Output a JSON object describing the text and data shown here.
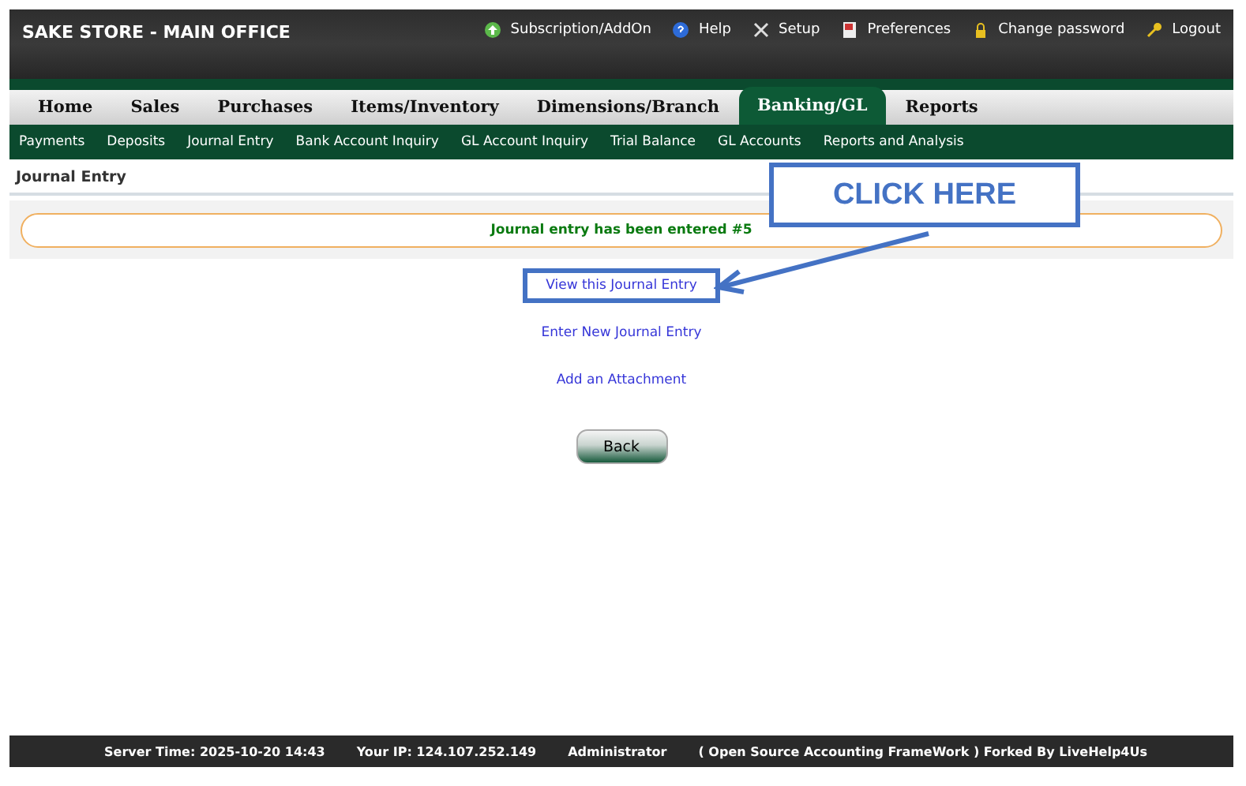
{
  "header": {
    "company": "SAKE STORE - MAIN OFFICE",
    "links": [
      {
        "kind": "addon",
        "label": "Subscription/AddOn"
      },
      {
        "kind": "help",
        "label": "Help"
      },
      {
        "kind": "setup",
        "label": "Setup"
      },
      {
        "kind": "preferences",
        "label": "Preferences"
      },
      {
        "kind": "password",
        "label": "Change password"
      },
      {
        "kind": "logout",
        "label": "Logout"
      }
    ]
  },
  "tabs": [
    {
      "label": "Home",
      "selected": false
    },
    {
      "label": "Sales",
      "selected": false
    },
    {
      "label": "Purchases",
      "selected": false
    },
    {
      "label": "Items/Inventory",
      "selected": false
    },
    {
      "label": "Dimensions/Branch",
      "selected": false
    },
    {
      "label": "Banking/GL",
      "selected": true
    },
    {
      "label": "Reports",
      "selected": false
    }
  ],
  "subnav": [
    "Payments",
    "Deposits",
    "Journal Entry",
    "Bank Account Inquiry",
    "GL Account Inquiry",
    "Trial Balance",
    "GL Accounts",
    "Reports and Analysis"
  ],
  "page_title": "Journal Entry",
  "message": "Journal entry has been entered #5",
  "links": [
    {
      "label": "View this Journal Entry",
      "highlighted": true
    },
    {
      "label": "Enter New Journal Entry",
      "highlighted": false
    },
    {
      "label": "Add an Attachment",
      "highlighted": false
    }
  ],
  "back_button": "Back",
  "callout": "CLICK HERE",
  "footer": [
    "Server Time: 2025-10-20 14:43",
    "Your IP: 124.107.252.149",
    "Administrator",
    "( Open Source Accounting FrameWork ) Forked By LiveHelp4Us"
  ]
}
